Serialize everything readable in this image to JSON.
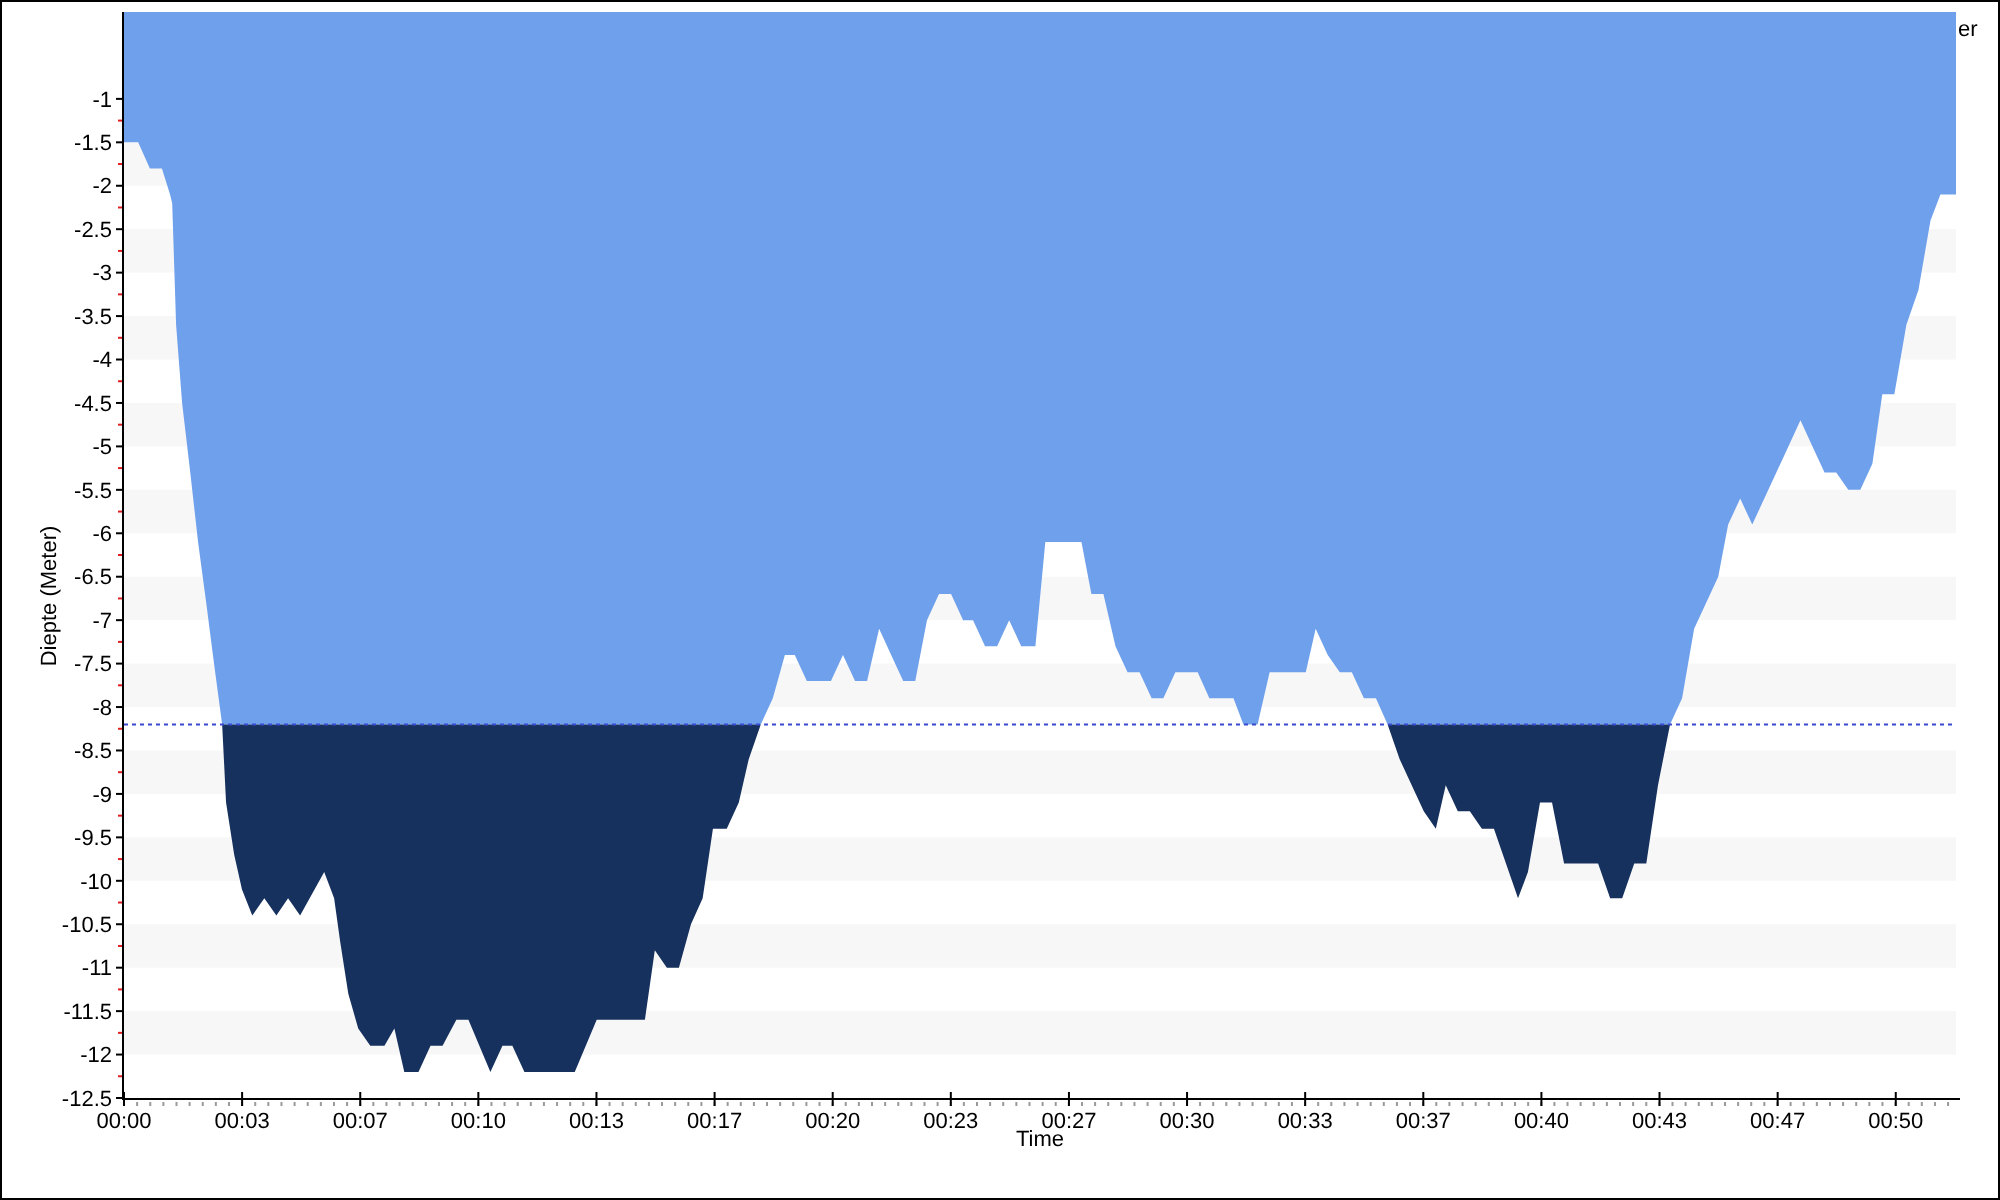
{
  "chart": {
    "legend": {
      "text": "er"
    },
    "chart_data": {
      "type": "area",
      "stacked": true,
      "xlabel": "Time",
      "ylabel": "Diepte (Meter)",
      "xlim": [
        0,
        51.7
      ],
      "ylim": [
        -12.5,
        0
      ],
      "xticks": [
        {
          "value": 0,
          "label": "00:00"
        },
        {
          "value": 3.333,
          "label": "00:03"
        },
        {
          "value": 6.667,
          "label": "00:07"
        },
        {
          "value": 10,
          "label": "00:10"
        },
        {
          "value": 13.333,
          "label": "00:13"
        },
        {
          "value": 16.667,
          "label": "00:17"
        },
        {
          "value": 20,
          "label": "00:20"
        },
        {
          "value": 23.333,
          "label": "00:23"
        },
        {
          "value": 26.667,
          "label": "00:27"
        },
        {
          "value": 30,
          "label": "00:30"
        },
        {
          "value": 33.333,
          "label": "00:33"
        },
        {
          "value": 36.667,
          "label": "00:37"
        },
        {
          "value": 40,
          "label": "00:40"
        },
        {
          "value": 43.333,
          "label": "00:43"
        },
        {
          "value": 46.667,
          "label": "00:47"
        },
        {
          "value": 50,
          "label": "00:50"
        }
      ],
      "yticks": [
        -1,
        -1.5,
        -2,
        -2.5,
        -3,
        -3.5,
        -4,
        -4.5,
        -5,
        -5.5,
        -6,
        -6.5,
        -7,
        -7.5,
        -8,
        -8.5,
        -9,
        -9.5,
        -10,
        -10.5,
        -11,
        -11.5,
        -12,
        -12.5
      ],
      "x": [
        0,
        0.4,
        0.73,
        1.07,
        1.3,
        1.36,
        1.47,
        1.64,
        1.87,
        2.09,
        2.32,
        2.54,
        2.77,
        2.88,
        3.11,
        3.33,
        3.62,
        3.96,
        4.3,
        4.63,
        4.97,
        5.65,
        5.93,
        6.1,
        6.33,
        6.61,
        6.95,
        7.35,
        7.63,
        7.91,
        8.31,
        8.65,
        8.99,
        9.38,
        9.72,
        10.34,
        10.68,
        10.96,
        11.3,
        12.72,
        13.34,
        14.7,
        14.98,
        15.32,
        15.66,
        16.0,
        16.33,
        16.62,
        17.01,
        17.35,
        17.63,
        17.97,
        18.31,
        18.65,
        18.93,
        19.27,
        19.95,
        20.29,
        20.63,
        20.97,
        21.31,
        21.65,
        21.99,
        22.33,
        22.66,
        23.0,
        23.34,
        23.68,
        23.96,
        24.3,
        24.64,
        24.98,
        25.32,
        25.72,
        26.0,
        27.02,
        27.3,
        27.64,
        27.98,
        28.32,
        28.66,
        29.0,
        29.33,
        29.67,
        30.3,
        30.63,
        31.31,
        31.59,
        31.99,
        32.33,
        33.35,
        33.63,
        33.97,
        34.31,
        34.65,
        34.99,
        35.33,
        35.66,
        36.0,
        36.34,
        36.68,
        37.02,
        37.3,
        37.64,
        37.98,
        38.32,
        38.66,
        39.0,
        39.34,
        39.62,
        39.96,
        40.3,
        40.64,
        41.6,
        41.94,
        42.28,
        42.62,
        42.96,
        43.29,
        43.63,
        43.97,
        44.31,
        44.65,
        44.99,
        45.27,
        45.61,
        45.95,
        46.29,
        46.63,
        46.97,
        47.31,
        47.65,
        47.99,
        48.32,
        48.66,
        49.0,
        49.34,
        49.62,
        49.96,
        50.3,
        50.64,
        50.98,
        51.26,
        51.7
      ],
      "series": [
        {
          "color": "#6fa0ec",
          "values": [
            -1.5,
            -1.5,
            -1.8,
            -1.8,
            -2.1,
            -2.2,
            -3.6,
            -4.5,
            -5.3,
            -6.1,
            -6.8,
            -7.5,
            -8.2,
            -8.2,
            -8.2,
            -8.2,
            -8.2,
            -8.2,
            -8.2,
            -8.2,
            -8.2,
            -8.2,
            -8.2,
            -8.2,
            -8.2,
            -8.2,
            -8.2,
            -8.2,
            -8.2,
            -8.2,
            -8.2,
            -8.2,
            -8.2,
            -8.2,
            -8.2,
            -8.2,
            -8.2,
            -8.2,
            -8.2,
            -8.2,
            -8.2,
            -8.2,
            -8.2,
            -8.2,
            -8.2,
            -8.2,
            -8.2,
            -8.2,
            -8.2,
            -8.2,
            -8.2,
            -8.2,
            -7.9,
            -7.4,
            -7.4,
            -7.7,
            -7.7,
            -7.4,
            -7.7,
            -7.7,
            -7.1,
            -7.4,
            -7.7,
            -7.7,
            -7.0,
            -6.7,
            -6.7,
            -7.0,
            -7.0,
            -7.3,
            -7.3,
            -7.0,
            -7.3,
            -7.3,
            -6.1,
            -6.1,
            -6.7,
            -6.7,
            -7.3,
            -7.6,
            -7.6,
            -7.9,
            -7.9,
            -7.6,
            -7.6,
            -7.9,
            -7.9,
            -8.2,
            -8.2,
            -7.6,
            -7.6,
            -7.1,
            -7.4,
            -7.6,
            -7.6,
            -7.9,
            -7.9,
            -8.2,
            -8.2,
            -8.2,
            -8.2,
            -8.2,
            -8.2,
            -8.2,
            -8.2,
            -8.2,
            -8.2,
            -8.2,
            -8.2,
            -8.2,
            -8.2,
            -8.2,
            -8.2,
            -8.2,
            -8.2,
            -8.2,
            -8.2,
            -8.2,
            -8.2,
            -8.2,
            -7.9,
            -7.1,
            -6.8,
            -6.5,
            -5.9,
            -5.6,
            -5.9,
            -5.6,
            -5.3,
            -5.0,
            -4.7,
            -5.0,
            -5.3,
            -5.3,
            -5.5,
            -5.5,
            -5.2,
            -4.4,
            -4.4,
            -3.6,
            -3.2,
            -2.4,
            -2.1,
            -2.1
          ]
        },
        {
          "color": "#16315e",
          "values": [
            null,
            null,
            null,
            null,
            null,
            null,
            null,
            null,
            null,
            null,
            null,
            null,
            0,
            -0.9,
            -1.5,
            -1.9,
            -2.2,
            -2.0,
            -2.2,
            -2.0,
            -2.2,
            -1.7,
            -2.0,
            -2.5,
            -3.1,
            -3.5,
            -3.7,
            -3.7,
            -3.5,
            -4.0,
            -4.0,
            -3.7,
            -3.7,
            -3.4,
            -3.4,
            -4.0,
            -3.7,
            -3.7,
            -4.0,
            -4.0,
            -3.4,
            -3.4,
            -2.6,
            -2.8,
            -2.8,
            -2.3,
            -2.0,
            -1.2,
            -1.2,
            -0.9,
            -0.4,
            0,
            null,
            null,
            null,
            null,
            null,
            null,
            null,
            null,
            null,
            null,
            null,
            null,
            null,
            null,
            null,
            null,
            null,
            null,
            null,
            null,
            null,
            null,
            null,
            null,
            null,
            null,
            null,
            null,
            null,
            null,
            null,
            null,
            null,
            null,
            null,
            null,
            null,
            null,
            null,
            null,
            null,
            null,
            null,
            null,
            null,
            0,
            -0.4,
            -0.7,
            -1.0,
            -1.2,
            -0.7,
            -1.0,
            -1.0,
            -1.2,
            -1.2,
            -1.6,
            -2.0,
            -1.7,
            -0.9,
            -0.9,
            -1.6,
            -1.6,
            -2.0,
            -2.0,
            -1.6,
            -1.6,
            -0.7,
            0,
            null,
            null,
            null,
            null,
            null,
            null,
            null,
            null,
            null,
            null,
            null,
            null,
            null,
            null,
            null,
            null,
            null,
            null,
            null,
            null,
            null,
            null,
            null,
            null
          ]
        }
      ],
      "ref_lines": [
        {
          "axis": "y",
          "value": -8.2
        }
      ]
    }
  }
}
